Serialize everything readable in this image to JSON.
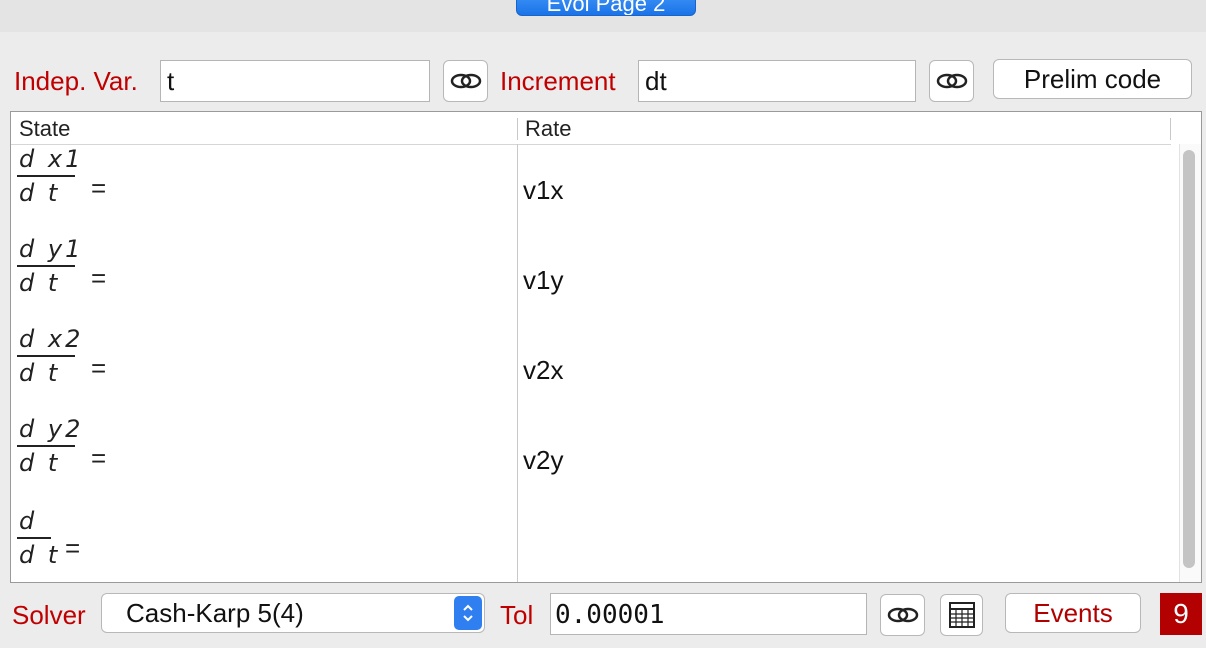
{
  "tab": {
    "label": "Evol Page 2"
  },
  "header": {
    "indep_var_label": "Indep. Var.",
    "indep_var_value": "t",
    "increment_label": "Increment",
    "increment_value": "dt",
    "prelim_button": "Prelim code"
  },
  "table": {
    "columns": [
      "State",
      "Rate"
    ],
    "rows": [
      {
        "state_num": "d x1",
        "state_den": "d t",
        "equals": "=",
        "rate": "v1x"
      },
      {
        "state_num": "d y1",
        "state_den": "d t",
        "equals": "=",
        "rate": "v1y"
      },
      {
        "state_num": "d x2",
        "state_den": "d t",
        "equals": "=",
        "rate": "v2x"
      },
      {
        "state_num": "d y2",
        "state_den": "d t",
        "equals": "=",
        "rate": "v2y"
      },
      {
        "state_num": "d",
        "state_den": "d t",
        "equals": "=",
        "rate": ""
      }
    ]
  },
  "footer": {
    "solver_label": "Solver",
    "solver_value": "Cash-Karp 5(4)",
    "tol_label": "Tol",
    "tol_value": "0.00001",
    "events_button": "Events",
    "events_count": "9"
  },
  "icons": {
    "link": "link-icon",
    "grid": "table-grid-icon",
    "updown": "chevron-updown-icon"
  },
  "colors": {
    "label_red": "#c00000",
    "tab_blue": "#1a73e8",
    "badge_red": "#b30000"
  }
}
